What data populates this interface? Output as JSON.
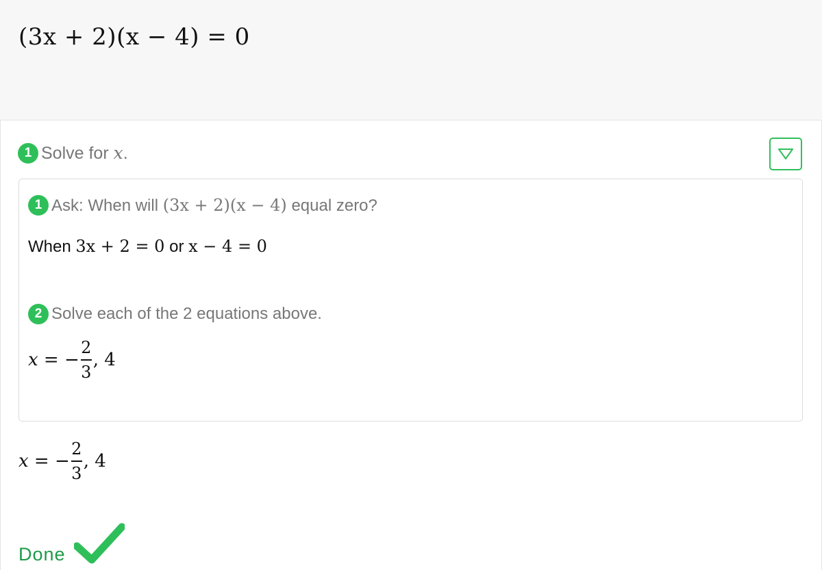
{
  "header": {
    "problem": "(3x + 2)(x − 4) = 0"
  },
  "step1": {
    "number": "1",
    "label_prefix": "Solve for ",
    "label_var": "x",
    "label_suffix": "."
  },
  "substeps": [
    {
      "number": "1",
      "title_prefix": "Ask: When will ",
      "title_math": "(3x + 2)(x − 4)",
      "title_suffix": " equal zero?",
      "body_prefix": "When ",
      "body_math1": "3x + 2 = 0",
      "body_or": " or ",
      "body_math2": "x − 4 = 0"
    },
    {
      "number": "2",
      "title": "Solve each of the 2 equations above.",
      "answer_var": "x",
      "answer_eq": " = −",
      "answer_num": "2",
      "answer_den": "3",
      "answer_rest": ", 4"
    }
  ],
  "final_answer": {
    "var": "x",
    "eq": " = −",
    "num": "2",
    "den": "3",
    "rest": ", 4"
  },
  "done_label": "Done",
  "icons": {
    "collapse": "triangle-down-icon",
    "done": "checkmark-icon"
  },
  "colors": {
    "accent": "#2fbf5a",
    "done_text": "#1e9a48"
  }
}
